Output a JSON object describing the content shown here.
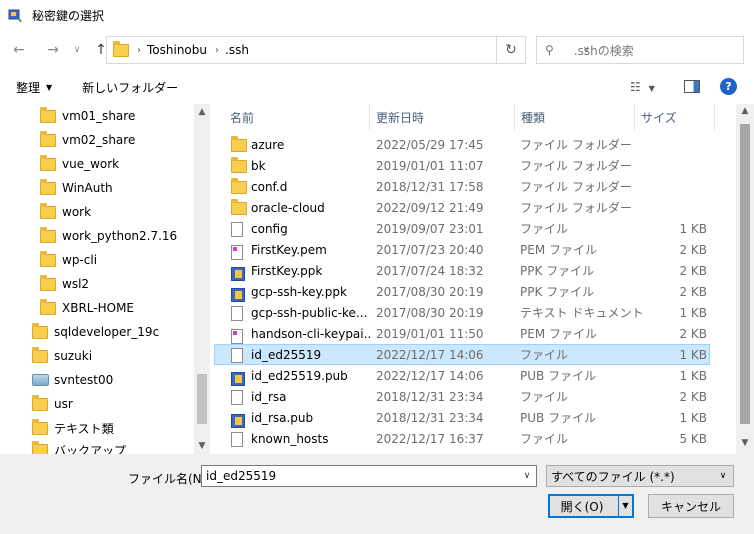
{
  "window": {
    "title": "秘密鍵の選択"
  },
  "address": {
    "crumbs": [
      "Toshinobu",
      ".ssh"
    ]
  },
  "search": {
    "placeholder": ".sshの検索"
  },
  "toolbar": {
    "organize": "整理",
    "new_folder": "新しいフォルダー"
  },
  "tree": [
    {
      "label": "vm01_share",
      "type": "folder",
      "level": 2
    },
    {
      "label": "vm02_share",
      "type": "folder",
      "level": 2
    },
    {
      "label": "vue_work",
      "type": "folder",
      "level": 2
    },
    {
      "label": "WinAuth",
      "type": "folder",
      "level": 2
    },
    {
      "label": "work",
      "type": "folder",
      "level": 2
    },
    {
      "label": "work_python2.7.16",
      "type": "folder",
      "level": 2
    },
    {
      "label": "wp-cli",
      "type": "folder",
      "level": 2
    },
    {
      "label": "wsl2",
      "type": "folder",
      "level": 2
    },
    {
      "label": "XBRL-HOME",
      "type": "folder",
      "level": 2
    },
    {
      "label": "sqldeveloper_19c",
      "type": "folder",
      "level": 1
    },
    {
      "label": "suzuki",
      "type": "folder",
      "level": 1
    },
    {
      "label": "svntest00",
      "type": "drive",
      "level": 1
    },
    {
      "label": "usr",
      "type": "folder",
      "level": 1
    },
    {
      "label": "テキスト類",
      "type": "folder",
      "level": 1
    },
    {
      "label": "バックアップ",
      "type": "folder",
      "level": 1
    }
  ],
  "columns": {
    "name": "名前",
    "date": "更新日時",
    "type": "種類",
    "size": "サイズ"
  },
  "files": [
    {
      "name": "azure",
      "date": "2022/05/29 17:45",
      "type": "ファイル フォルダー",
      "size": "",
      "icon": "folder"
    },
    {
      "name": "bk",
      "date": "2019/01/01 11:07",
      "type": "ファイル フォルダー",
      "size": "",
      "icon": "folder"
    },
    {
      "name": "conf.d",
      "date": "2018/12/31 17:58",
      "type": "ファイル フォルダー",
      "size": "",
      "icon": "folder"
    },
    {
      "name": "oracle-cloud",
      "date": "2022/09/12 21:49",
      "type": "ファイル フォルダー",
      "size": "",
      "icon": "folder"
    },
    {
      "name": "config",
      "date": "2019/09/07 23:01",
      "type": "ファイル",
      "size": "1 KB",
      "icon": "doc"
    },
    {
      "name": "FirstKey.pem",
      "date": "2017/07/23 20:40",
      "type": "PEM ファイル",
      "size": "2 KB",
      "icon": "pem"
    },
    {
      "name": "FirstKey.ppk",
      "date": "2017/07/24 18:32",
      "type": "PPK ファイル",
      "size": "2 KB",
      "icon": "ppk"
    },
    {
      "name": "gcp-ssh-key.ppk",
      "date": "2017/08/30 20:19",
      "type": "PPK ファイル",
      "size": "2 KB",
      "icon": "ppk"
    },
    {
      "name": "gcp-ssh-public-ke...",
      "date": "2017/08/30 20:19",
      "type": "テキスト ドキュメント",
      "size": "1 KB",
      "icon": "doc"
    },
    {
      "name": "handson-cli-keypai...",
      "date": "2019/01/01 11:50",
      "type": "PEM ファイル",
      "size": "2 KB",
      "icon": "pem"
    },
    {
      "name": "id_ed25519",
      "date": "2022/12/17 14:06",
      "type": "ファイル",
      "size": "1 KB",
      "icon": "doc",
      "selected": true
    },
    {
      "name": "id_ed25519.pub",
      "date": "2022/12/17 14:06",
      "type": "PUB ファイル",
      "size": "1 KB",
      "icon": "ppk"
    },
    {
      "name": "id_rsa",
      "date": "2018/12/31 23:34",
      "type": "ファイル",
      "size": "2 KB",
      "icon": "doc"
    },
    {
      "name": "id_rsa.pub",
      "date": "2018/12/31 23:34",
      "type": "PUB ファイル",
      "size": "1 KB",
      "icon": "ppk"
    },
    {
      "name": "known_hosts",
      "date": "2022/12/17 16:37",
      "type": "ファイル",
      "size": "5 KB",
      "icon": "doc"
    }
  ],
  "footer": {
    "filename_label": "ファイル名(N):",
    "filename_value": "id_ed25519",
    "filter_value": "すべてのファイル (*.*)",
    "open_label": "開く(O)",
    "cancel_label": "キャンセル"
  }
}
